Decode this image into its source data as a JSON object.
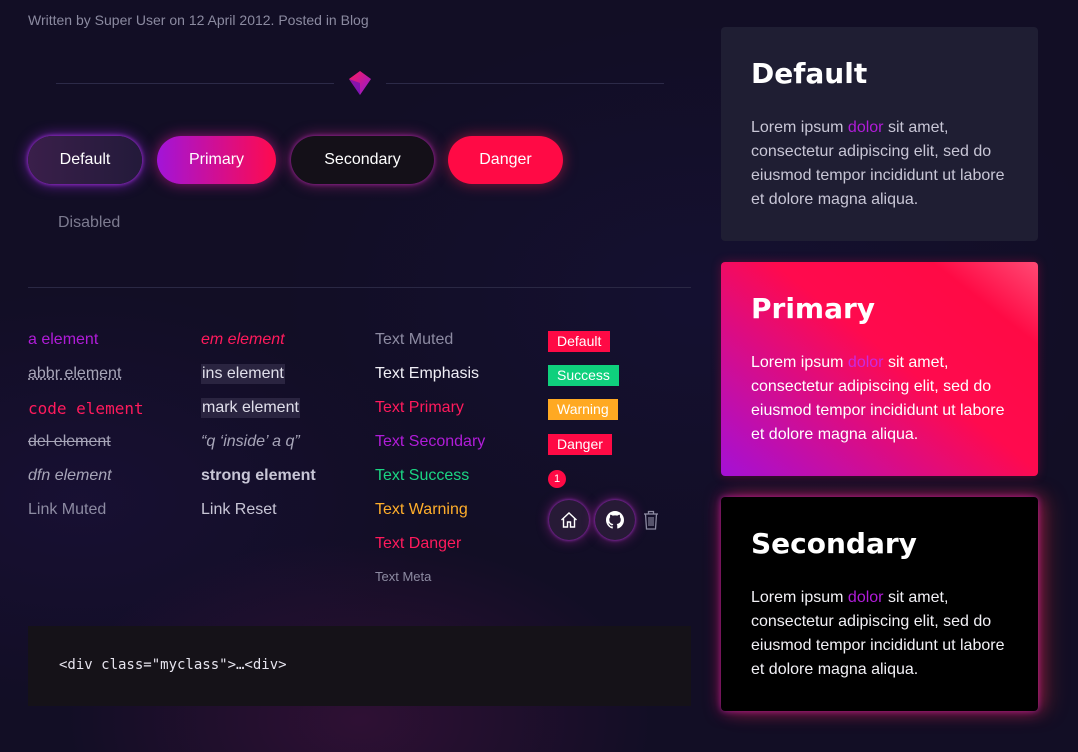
{
  "meta": {
    "written_by": "Written by",
    "author": "Super User",
    "on": "on",
    "date": "12 April 2012.",
    "posted_in": "Posted in",
    "category": "Blog"
  },
  "buttons": {
    "default": "Default",
    "primary": "Primary",
    "secondary": "Secondary",
    "danger": "Danger",
    "disabled": "Disabled"
  },
  "typography": {
    "a_element": "a element",
    "abbr_element": "abbr element",
    "code_element": "code element",
    "del_element": "del element",
    "dfn_element": "dfn element",
    "link_muted": "Link Muted",
    "em_element": "em element",
    "ins_element": "ins element",
    "mark_element": "mark element",
    "q_element": "“q ‘inside’ a q”",
    "strong_element": "strong element",
    "link_reset": "Link Reset",
    "text_muted": "Text Muted",
    "text_emphasis": "Text Emphasis",
    "text_primary": "Text Primary",
    "text_secondary": "Text Secondary",
    "text_success": "Text Success",
    "text_warning": "Text Warning",
    "text_danger": "Text Danger",
    "text_meta": "Text Meta"
  },
  "labels": {
    "default": "Default",
    "success": "Success",
    "warning": "Warning",
    "danger": "Danger",
    "badge_count": "1"
  },
  "icons": [
    "home-icon",
    "github-icon",
    "trash-icon"
  ],
  "code_block": "<div class=\"myclass\">…<div>",
  "cards": {
    "default": {
      "title": "Default",
      "text_before": "Lorem ipsum ",
      "highlight": "dolor",
      "text_after": " sit amet, consectetur adipiscing elit, sed do eiusmod tempor incididunt ut labore et dolore magna aliqua."
    },
    "primary": {
      "title": "Primary",
      "text_before": "Lorem ipsum ",
      "highlight": "dolor",
      "text_after": " sit amet, consectetur adipiscing elit, sed do eiusmod tempor incididunt ut labore et dolore magna aliqua."
    },
    "secondary": {
      "title": "Secondary",
      "text_before": "Lorem ipsum ",
      "highlight": "dolor",
      "text_after": " sit amet, consectetur adipiscing elit, sed do eiusmod tempor incididunt ut labore et dolore magna aliqua."
    }
  },
  "colors": {
    "accent_purple": "#b01cd8",
    "accent_red": "#ff0a45",
    "success": "#0fd07d",
    "warning": "#ffa922"
  }
}
